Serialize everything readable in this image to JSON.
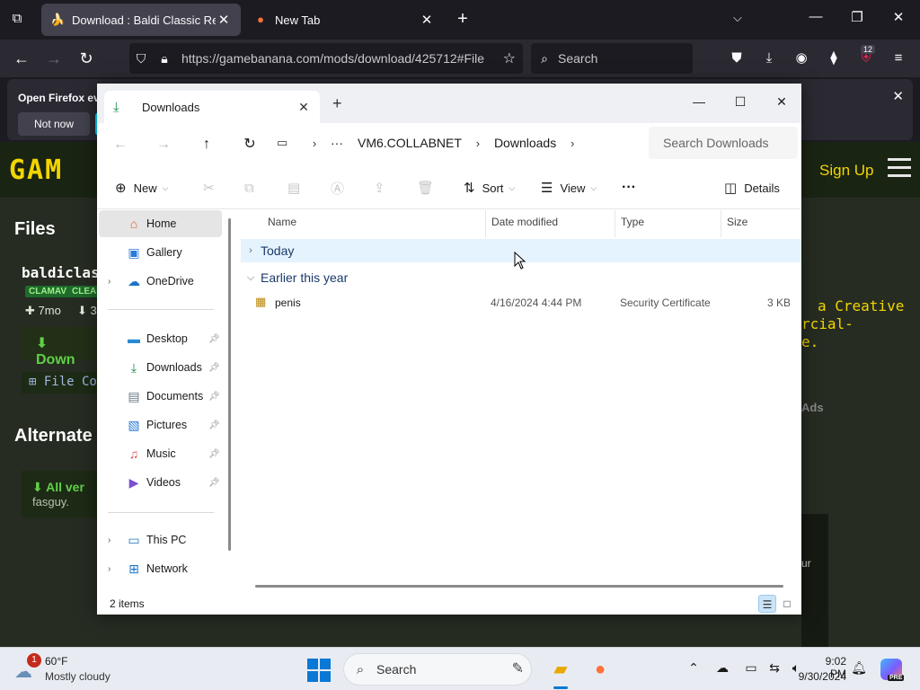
{
  "browser": {
    "tabs": [
      {
        "title": "Download : Baldi Classic Remas",
        "active": true,
        "icon": "banana-icon"
      },
      {
        "title": "New Tab",
        "active": false,
        "icon": "firefox-icon"
      }
    ],
    "url": "https://gamebanana.com/mods/download/425712#File",
    "search_placeholder": "Search",
    "extension_badge": "12"
  },
  "notification": {
    "message": "Open Firefox ev",
    "not_now": "Not now"
  },
  "site": {
    "logo": "GAM",
    "sign_up": "Sign Up",
    "files_heading": "Files",
    "file_name": "baldiclas",
    "tag_clamav": "CLAMAV",
    "tag_clean": "CLEAN",
    "meta_age": "✚ 7mo",
    "meta_dl": "⬇ 3",
    "download_btn": "⬇ Down",
    "file_contents": "⊞ File Co",
    "alternate_heading": "Alternate",
    "alt_title": "⬇ All ver",
    "alt_sub": "fasguy.",
    "license_line1": "a Creative",
    "license_line2": "rcial-",
    "license_line3": "e.",
    "ads": "Ads",
    "dark_text": "ur"
  },
  "explorer": {
    "tab_title": "Downloads",
    "path": {
      "more": "···",
      "segments": [
        "VM6.COLLABNET",
        "Downloads"
      ]
    },
    "search_placeholder": "Search Downloads",
    "toolbar": {
      "new": "New",
      "sort": "Sort",
      "view": "View",
      "more": "···",
      "details": "Details"
    },
    "sidebar": {
      "home": "Home",
      "gallery": "Gallery",
      "onedrive": "OneDrive",
      "desktop": "Desktop",
      "downloads": "Downloads",
      "documents": "Documents",
      "pictures": "Pictures",
      "music": "Music",
      "videos": "Videos",
      "this_pc": "This PC",
      "network": "Network"
    },
    "columns": {
      "name": "Name",
      "date": "Date modified",
      "type": "Type",
      "size": "Size"
    },
    "groups": {
      "today": "Today",
      "earlier": "Earlier this year"
    },
    "files": [
      {
        "name": "penis",
        "date": "4/16/2024 4:44 PM",
        "type": "Security Certificate",
        "size": "3 KB",
        "icon": "certificate-icon"
      }
    ],
    "status": "2 items"
  },
  "taskbar": {
    "weather_badge": "1",
    "temperature": "60°F",
    "weather": "Mostly cloudy",
    "search": "Search",
    "time": "9:02 PM",
    "date": "9/30/2024",
    "copilot_badge": "PRE"
  },
  "colors": {
    "accent": "#0a78d4",
    "site_yellow": "#f2d600",
    "site_green": "#5fd047",
    "download_icon": "#1e8a4d"
  }
}
